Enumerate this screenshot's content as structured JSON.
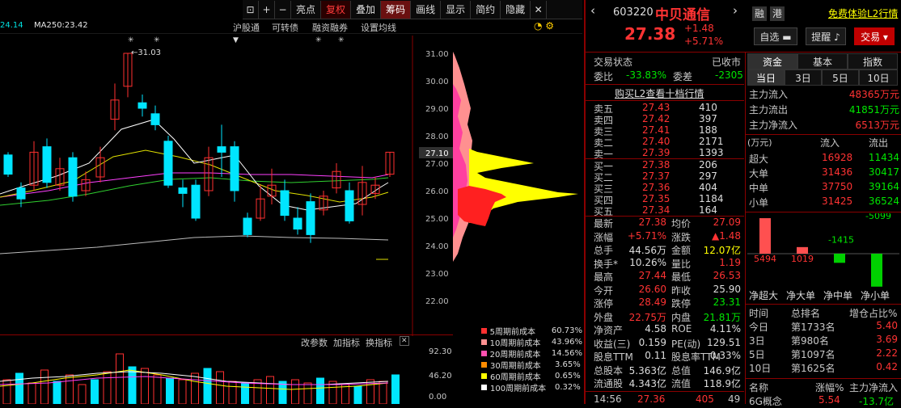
{
  "toolbar": {
    "items": [
      "亮点",
      "复权",
      "叠加",
      "筹码",
      "画线",
      "显示",
      "简约",
      "隐藏"
    ]
  },
  "subbar": {
    "ma_prev": "24.14",
    "ma250": "MA250:23.42",
    "tabs": [
      "沪股通",
      "可转债",
      "融资融券",
      "设置均线"
    ]
  },
  "main_chart": {
    "high_label": "←31.03",
    "price_ticks": [
      "31.00",
      "30.00",
      "29.00",
      "28.00",
      "27.00",
      "26.00",
      "25.00",
      "24.00",
      "23.00",
      "22.00"
    ],
    "current_tag": "27.10"
  },
  "vol_header": {
    "items": [
      "改参数",
      "加指标",
      "换指标"
    ],
    "ticks": [
      "92.30",
      "46.20",
      "0.00"
    ]
  },
  "legend": [
    {
      "name": "5周期前成本",
      "value": "60.73%",
      "color": "#ff3030"
    },
    {
      "name": "10周期前成本",
      "value": "43.96%",
      "color": "#ff9090"
    },
    {
      "name": "20周期前成本",
      "value": "14.56%",
      "color": "#ff50b0"
    },
    {
      "name": "30周期前成本",
      "value": "3.65%",
      "color": "#ff8c00"
    },
    {
      "name": "60周期前成本",
      "value": "0.65%",
      "color": "#ffff00"
    },
    {
      "name": "100周期前成本",
      "value": "0.32%",
      "color": "#ffffff"
    }
  ],
  "stock": {
    "code": "603220",
    "name": "中贝通信",
    "rong": "融",
    "gang": "港",
    "l2": "免费体验L2行情",
    "price": "27.38",
    "change": "+1.48",
    "pct": "+5.71%",
    "btn_zixuan": "自选",
    "btn_tixing": "提醒",
    "btn_jiaoyi": "交易"
  },
  "status": {
    "label": "交易状态",
    "value": "已收市",
    "wb_label": "委比",
    "wb": "-33.83%",
    "wc_label": "委差",
    "wc": "-2305"
  },
  "l2_link": "购买L2查看十档行情",
  "asks": [
    {
      "n": "卖五",
      "p": "27.43",
      "v": "410"
    },
    {
      "n": "卖四",
      "p": "27.42",
      "v": "397"
    },
    {
      "n": "卖三",
      "p": "27.41",
      "v": "188"
    },
    {
      "n": "卖二",
      "p": "27.40",
      "v": "2171"
    },
    {
      "n": "卖一",
      "p": "27.39",
      "v": "1393"
    }
  ],
  "bids": [
    {
      "n": "买一",
      "p": "27.38",
      "v": "206"
    },
    {
      "n": "买二",
      "p": "27.37",
      "v": "297"
    },
    {
      "n": "买三",
      "p": "27.36",
      "v": "404"
    },
    {
      "n": "买四",
      "p": "27.35",
      "v": "1184"
    },
    {
      "n": "买五",
      "p": "27.34",
      "v": "164"
    }
  ],
  "stats": [
    {
      "l1": "最新",
      "v1": "27.38",
      "l2": "均价",
      "v2": "27.09"
    },
    {
      "l1": "涨幅",
      "v1": "+5.71%",
      "l2": "涨跌",
      "v2": "▲1.48"
    },
    {
      "l1": "总手",
      "v1": "44.56万",
      "l2": "金额",
      "v2": "12.07亿"
    },
    {
      "l1": "换手*",
      "v1": "10.26%",
      "l2": "量比",
      "v2": "1.19"
    },
    {
      "l1": "最高",
      "v1": "27.44",
      "l2": "最低",
      "v2": "26.53"
    },
    {
      "l1": "今开",
      "v1": "26.60",
      "l2": "昨收",
      "v2": "25.90"
    },
    {
      "l1": "涨停",
      "v1": "28.49",
      "l2": "跌停",
      "v2": "23.31"
    },
    {
      "l1": "外盘",
      "v1": "22.75万",
      "l2": "内盘",
      "v2": "21.81万"
    },
    {
      "l1": "净资产",
      "v1": "4.58",
      "l2": "ROE",
      "v2": "4.11%"
    },
    {
      "l1": "收益(三)",
      "v1": "0.159",
      "l2": "PE(动)",
      "v2": "129.51"
    },
    {
      "l1": "股息TTM",
      "v1": "0.11",
      "l2": "股息率TTM",
      "v2": "0.33%"
    },
    {
      "l1": "总股本",
      "v1": "5.363亿",
      "l2": "总值",
      "v2": "146.9亿"
    },
    {
      "l1": "流通股",
      "v1": "4.343亿",
      "l2": "流值",
      "v2": "118.9亿"
    }
  ],
  "last_trade": {
    "time": "14:56",
    "price": "27.36",
    "vol": "405",
    "num": "49"
  },
  "fund_tabs": [
    "资金",
    "基本",
    "指数"
  ],
  "day_tabs": [
    "当日",
    "3日",
    "5日",
    "10日"
  ],
  "flow": [
    {
      "l": "主力流入",
      "v": "48365万元"
    },
    {
      "l": "主力流出",
      "v": "41851万元"
    },
    {
      "l": "主力净流入",
      "v": "6513万元"
    }
  ],
  "flow_table": {
    "unit": "(万元)",
    "in": "流入",
    "out": "流出",
    "rows": [
      {
        "n": "超大",
        "i": "16928",
        "o": "11434"
      },
      {
        "n": "大单",
        "i": "31436",
        "o": "30417"
      },
      {
        "n": "中单",
        "i": "37750",
        "o": "39164"
      },
      {
        "n": "小单",
        "i": "31425",
        "o": "36524"
      }
    ]
  },
  "bars": [
    {
      "label": "5494",
      "name": "净超大",
      "value": 5494
    },
    {
      "label": "1019",
      "name": "净大单",
      "value": 1019
    },
    {
      "label": "-1415",
      "name": "净中单",
      "value": -1415
    },
    {
      "label": "-5099",
      "name": "净小单",
      "value": -5099
    }
  ],
  "rank": {
    "h1": "时间",
    "h2": "总排名",
    "h3": "增仓占比%",
    "rows": [
      {
        "t": "今日",
        "r": "第1733名",
        "p": "5.40"
      },
      {
        "t": "3日",
        "r": "第980名",
        "p": "3.69"
      },
      {
        "t": "5日",
        "r": "第1097名",
        "p": "2.22"
      },
      {
        "t": "10日",
        "r": "第1625名",
        "p": "0.42"
      }
    ]
  },
  "sector": {
    "h1": "名称",
    "h2": "涨幅%",
    "h3": "主力净流入",
    "name": "6G概念",
    "pct": "5.54",
    "flow": "-13.7亿"
  }
}
